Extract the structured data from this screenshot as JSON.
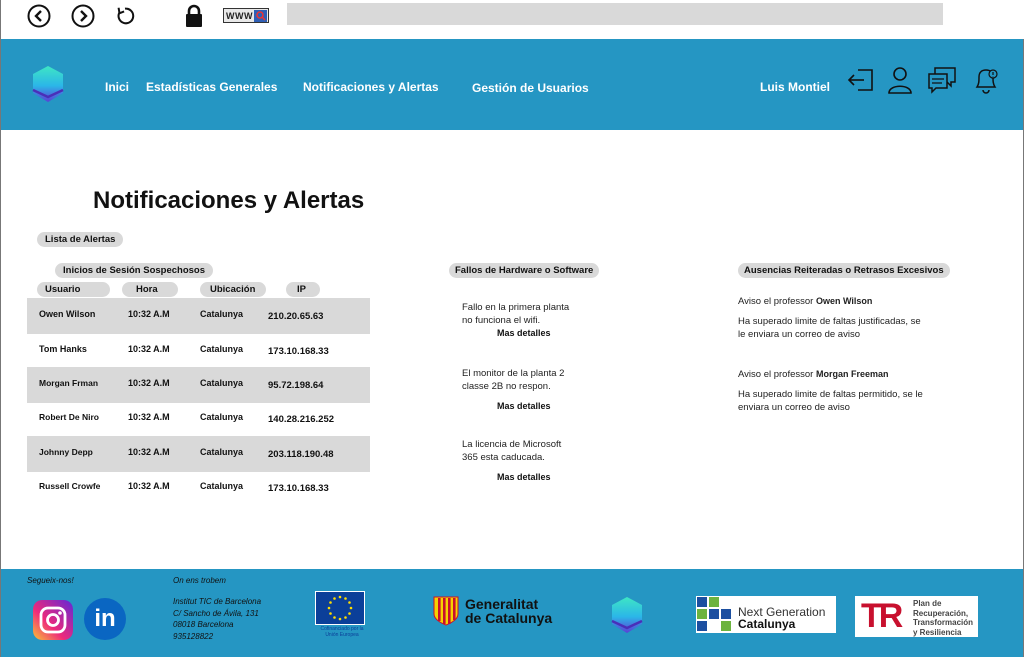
{
  "browser": {
    "back_icon": "back-arrow-icon",
    "forward_icon": "forward-arrow-icon",
    "reload_icon": "reload-icon",
    "lock_icon": "lock-icon",
    "www_label": "WWW",
    "url_value": ""
  },
  "header": {
    "nav": [
      "Inici",
      "Estadísticas Generales",
      "Notificaciones y Alertas",
      "Gestión de Usuarios"
    ],
    "user_name": "Luis Montiel",
    "icons": [
      "logout-icon",
      "user-icon",
      "chat-icon",
      "bell-icon"
    ]
  },
  "main": {
    "title": "Notificaciones y Alertas",
    "alert_list_label": "Lista de Alertas",
    "suspicious": {
      "title": "Inicios de Sesión Sospechosos",
      "columns": [
        "Usuario",
        "Hora",
        "Ubicación",
        "IP"
      ],
      "rows": [
        {
          "usuario": "Owen Wilson",
          "hora": "10:32 A.M",
          "ubicacion": "Catalunya",
          "ip": "210.20.65.63"
        },
        {
          "usuario": "Tom Hanks",
          "hora": "10:32 A.M",
          "ubicacion": "Catalunya",
          "ip": "173.10.168.33"
        },
        {
          "usuario": "Morgan Frman",
          "hora": "10:32 A.M",
          "ubicacion": "Catalunya",
          "ip": "95.72.198.64"
        },
        {
          "usuario": "Robert De Niro",
          "hora": "10:32 A.M",
          "ubicacion": "Catalunya",
          "ip": "140.28.216.252"
        },
        {
          "usuario": "Johnny Depp",
          "hora": "10:32 A.M",
          "ubicacion": "Catalunya",
          "ip": "203.118.190.48"
        },
        {
          "usuario": "Russell Crowfe",
          "hora": "10:32 A.M",
          "ubicacion": "Catalunya",
          "ip": "173.10.168.33"
        }
      ]
    },
    "hardware": {
      "title": "Fallos de Hardware o Software",
      "more_label": "Mas detalles",
      "items": [
        {
          "line1": "Fallo en la primera planta",
          "line2": "no funciona el wifi."
        },
        {
          "line1": "El monitor de la planta 2",
          "line2": "classe 2B no respon."
        },
        {
          "line1": "La licencia de Microsoft",
          "line2": "365 esta caducada."
        }
      ]
    },
    "absences": {
      "title": "Ausencias Reiteradas o Retrasos Excesivos",
      "items": [
        {
          "prefix": "Aviso el professor",
          "name": "Owen Wilson",
          "line1": "Ha superado limite de faltas justificadas, se",
          "line2": "le enviara un correo de aviso"
        },
        {
          "prefix": "Aviso el professor",
          "name": "Morgan Freeman",
          "line1": "Ha superado limite de faltas permitido, se le",
          "line2": "enviara un correo de aviso"
        }
      ]
    }
  },
  "footer": {
    "follow_label": "Segueix-nos!",
    "where_label": "On ens trobem",
    "address": [
      "Institut TIC de Barcelona",
      "C/ Sancho de Ávila, 131",
      "08018 Barcelona",
      "935128822"
    ],
    "social_icons": [
      "instagram-icon",
      "linkedin-icon"
    ],
    "linkedin_text": "in",
    "eu_caption": "Cofinanciado por la Unión Europea",
    "generalitat": [
      "Generalitat",
      "de Catalunya"
    ],
    "next_gen": [
      "Next Generation",
      "Catalunya"
    ],
    "plan": [
      "Plan de",
      "Recuperación,",
      "Transformación",
      "y Resiliencia"
    ],
    "plan_letters": "TR"
  },
  "colors": {
    "brand_blue": "#2596c3",
    "row_shade": "#d9d9d9"
  }
}
